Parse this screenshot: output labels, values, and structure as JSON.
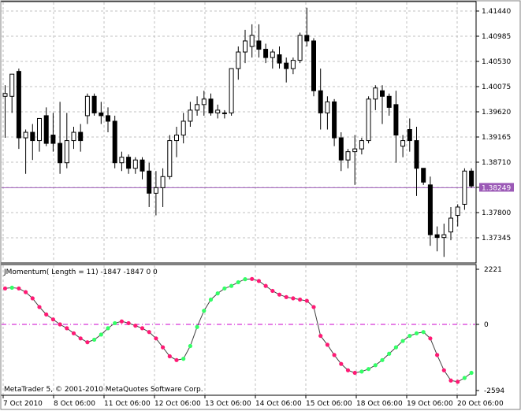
{
  "chart_data": [
    {
      "type": "candlestick",
      "instrument_timeframe": "",
      "price_axis_labels": [
        "1.41440",
        "1.40985",
        "1.40530",
        "1.40075",
        "1.39620",
        "1.39165",
        "1.38710",
        "1.38255",
        "1.37800",
        "1.37345"
      ],
      "current_price_label": "1.38249",
      "current_price": 1.38249,
      "ylim": [
        1.3695,
        1.4175
      ],
      "grid": true,
      "bullish_color": "#ffffff",
      "bearish_color": "#000000",
      "price_line_color": "#9b59b6",
      "candles": [
        {
          "o": 1.399,
          "h": 1.401,
          "l": 1.3915,
          "c": 1.3995
        },
        {
          "o": 1.399,
          "h": 1.402,
          "l": 1.396,
          "c": 1.403
        },
        {
          "o": 1.4035,
          "h": 1.404,
          "l": 1.3895,
          "c": 1.3915
        },
        {
          "o": 1.3915,
          "h": 1.393,
          "l": 1.385,
          "c": 1.3925
        },
        {
          "o": 1.3925,
          "h": 1.394,
          "l": 1.3875,
          "c": 1.391
        },
        {
          "o": 1.391,
          "h": 1.395,
          "l": 1.389,
          "c": 1.395
        },
        {
          "o": 1.3955,
          "h": 1.397,
          "l": 1.39,
          "c": 1.3905
        },
        {
          "o": 1.392,
          "h": 1.396,
          "l": 1.389,
          "c": 1.3905
        },
        {
          "o": 1.3905,
          "h": 1.398,
          "l": 1.385,
          "c": 1.387
        },
        {
          "o": 1.387,
          "h": 1.396,
          "l": 1.386,
          "c": 1.391
        },
        {
          "o": 1.391,
          "h": 1.3935,
          "l": 1.3895,
          "c": 1.3925
        },
        {
          "o": 1.3925,
          "h": 1.394,
          "l": 1.389,
          "c": 1.391
        },
        {
          "o": 1.3955,
          "h": 1.3995,
          "l": 1.394,
          "c": 1.399
        },
        {
          "o": 1.399,
          "h": 1.3995,
          "l": 1.3955,
          "c": 1.396
        },
        {
          "o": 1.396,
          "h": 1.398,
          "l": 1.394,
          "c": 1.3955
        },
        {
          "o": 1.3955,
          "h": 1.397,
          "l": 1.3925,
          "c": 1.3945
        },
        {
          "o": 1.3945,
          "h": 1.3955,
          "l": 1.386,
          "c": 1.387
        },
        {
          "o": 1.387,
          "h": 1.389,
          "l": 1.3855,
          "c": 1.388
        },
        {
          "o": 1.388,
          "h": 1.3885,
          "l": 1.385,
          "c": 1.386
        },
        {
          "o": 1.386,
          "h": 1.388,
          "l": 1.385,
          "c": 1.3875
        },
        {
          "o": 1.3875,
          "h": 1.388,
          "l": 1.384,
          "c": 1.3855
        },
        {
          "o": 1.3855,
          "h": 1.387,
          "l": 1.379,
          "c": 1.3815
        },
        {
          "o": 1.3815,
          "h": 1.3855,
          "l": 1.3775,
          "c": 1.3825
        },
        {
          "o": 1.3825,
          "h": 1.386,
          "l": 1.379,
          "c": 1.3845
        },
        {
          "o": 1.3845,
          "h": 1.392,
          "l": 1.384,
          "c": 1.391
        },
        {
          "o": 1.391,
          "h": 1.3935,
          "l": 1.388,
          "c": 1.392
        },
        {
          "o": 1.392,
          "h": 1.396,
          "l": 1.3905,
          "c": 1.3945
        },
        {
          "o": 1.3945,
          "h": 1.398,
          "l": 1.3935,
          "c": 1.3965
        },
        {
          "o": 1.3965,
          "h": 1.399,
          "l": 1.3955,
          "c": 1.3975
        },
        {
          "o": 1.3975,
          "h": 1.4,
          "l": 1.3955,
          "c": 1.3985
        },
        {
          "o": 1.3985,
          "h": 1.3995,
          "l": 1.3955,
          "c": 1.396
        },
        {
          "o": 1.396,
          "h": 1.3975,
          "l": 1.395,
          "c": 1.3965
        },
        {
          "o": 1.396,
          "h": 1.3965,
          "l": 1.395,
          "c": 1.396
        },
        {
          "o": 1.396,
          "h": 1.4015,
          "l": 1.3955,
          "c": 1.404
        },
        {
          "o": 1.404,
          "h": 1.408,
          "l": 1.402,
          "c": 1.407
        },
        {
          "o": 1.407,
          "h": 1.411,
          "l": 1.405,
          "c": 1.409
        },
        {
          "o": 1.408,
          "h": 1.412,
          "l": 1.406,
          "c": 1.41
        },
        {
          "o": 1.409,
          "h": 1.412,
          "l": 1.406,
          "c": 1.4075
        },
        {
          "o": 1.4075,
          "h": 1.4085,
          "l": 1.405,
          "c": 1.406
        },
        {
          "o": 1.406,
          "h": 1.4075,
          "l": 1.404,
          "c": 1.407
        },
        {
          "o": 1.4065,
          "h": 1.408,
          "l": 1.404,
          "c": 1.405
        },
        {
          "o": 1.405,
          "h": 1.406,
          "l": 1.4015,
          "c": 1.404
        },
        {
          "o": 1.404,
          "h": 1.406,
          "l": 1.403,
          "c": 1.4055
        },
        {
          "o": 1.4055,
          "h": 1.4105,
          "l": 1.405,
          "c": 1.41
        },
        {
          "o": 1.41,
          "h": 1.415,
          "l": 1.408,
          "c": 1.409
        },
        {
          "o": 1.409,
          "h": 1.4095,
          "l": 1.399,
          "c": 1.4
        },
        {
          "o": 1.4,
          "h": 1.404,
          "l": 1.393,
          "c": 1.396
        },
        {
          "o": 1.396,
          "h": 1.399,
          "l": 1.393,
          "c": 1.398
        },
        {
          "o": 1.398,
          "h": 1.3985,
          "l": 1.39,
          "c": 1.3915
        },
        {
          "o": 1.3915,
          "h": 1.3925,
          "l": 1.3855,
          "c": 1.3875
        },
        {
          "o": 1.3875,
          "h": 1.3895,
          "l": 1.386,
          "c": 1.389
        },
        {
          "o": 1.389,
          "h": 1.392,
          "l": 1.383,
          "c": 1.3895
        },
        {
          "o": 1.3895,
          "h": 1.3915,
          "l": 1.3885,
          "c": 1.391
        },
        {
          "o": 1.391,
          "h": 1.399,
          "l": 1.3905,
          "c": 1.3985
        },
        {
          "o": 1.3985,
          "h": 1.401,
          "l": 1.3965,
          "c": 1.4005
        },
        {
          "o": 1.4,
          "h": 1.401,
          "l": 1.394,
          "c": 1.399
        },
        {
          "o": 1.399,
          "h": 1.3995,
          "l": 1.3955,
          "c": 1.397
        },
        {
          "o": 1.3975,
          "h": 1.4,
          "l": 1.387,
          "c": 1.392
        },
        {
          "o": 1.39,
          "h": 1.392,
          "l": 1.388,
          "c": 1.391
        },
        {
          "o": 1.393,
          "h": 1.395,
          "l": 1.389,
          "c": 1.391
        },
        {
          "o": 1.391,
          "h": 1.3935,
          "l": 1.381,
          "c": 1.386
        },
        {
          "o": 1.386,
          "h": 1.386,
          "l": 1.383,
          "c": 1.3835
        },
        {
          "o": 1.383,
          "h": 1.3845,
          "l": 1.372,
          "c": 1.374
        },
        {
          "o": 1.374,
          "h": 1.3755,
          "l": 1.371,
          "c": 1.3735
        },
        {
          "o": 1.3735,
          "h": 1.376,
          "l": 1.37,
          "c": 1.374
        },
        {
          "o": 1.3745,
          "h": 1.379,
          "l": 1.373,
          "c": 1.377
        },
        {
          "o": 1.3775,
          "h": 1.3795,
          "l": 1.3755,
          "c": 1.379
        },
        {
          "o": 1.3795,
          "h": 1.386,
          "l": 1.3785,
          "c": 1.3855
        },
        {
          "o": 1.3855,
          "h": 1.386,
          "l": 1.3825,
          "c": 1.3828
        }
      ]
    },
    {
      "type": "line",
      "title": "JMomentum( Length = 11) -1847 -1847 0 0",
      "axis_labels": [
        "2221",
        "0",
        "-2594"
      ],
      "ylim": [
        -2594,
        2221
      ],
      "zero_line_color": "#cc00cc",
      "up_color": "#33ff66",
      "down_color": "#ff1a75",
      "values": [
        1450,
        1480,
        1450,
        1300,
        1050,
        700,
        400,
        200,
        0,
        -150,
        -350,
        -550,
        -700,
        -600,
        -400,
        -150,
        50,
        120,
        50,
        -50,
        -150,
        -300,
        -550,
        -900,
        -1250,
        -1400,
        -1350,
        -850,
        -100,
        550,
        1000,
        1250,
        1450,
        1550,
        1700,
        1820,
        1830,
        1750,
        1550,
        1350,
        1200,
        1100,
        1050,
        1000,
        950,
        700,
        -450,
        -800,
        -1200,
        -1550,
        -1800,
        -1900,
        -1850,
        -1750,
        -1600,
        -1400,
        -1150,
        -900,
        -650,
        -450,
        -350,
        -300,
        -550,
        -1200,
        -1800,
        -2200,
        -2250,
        -2100,
        -1900
      ],
      "colors": [
        "d",
        "u",
        "d",
        "d",
        "d",
        "d",
        "d",
        "d",
        "d",
        "d",
        "d",
        "d",
        "d",
        "u",
        "u",
        "u",
        "u",
        "d",
        "d",
        "d",
        "d",
        "d",
        "d",
        "d",
        "d",
        "d",
        "u",
        "u",
        "u",
        "u",
        "u",
        "u",
        "u",
        "u",
        "u",
        "u",
        "d",
        "d",
        "d",
        "d",
        "d",
        "d",
        "d",
        "d",
        "d",
        "d",
        "d",
        "d",
        "d",
        "d",
        "d",
        "d",
        "u",
        "u",
        "u",
        "u",
        "u",
        "u",
        "u",
        "u",
        "u",
        "u",
        "d",
        "d",
        "d",
        "d",
        "d",
        "u",
        "u"
      ]
    }
  ],
  "time_axis_labels": [
    "7 Oct 2010",
    "8 Oct 06:00",
    "11 Oct 06:00",
    "12 Oct 06:00",
    "13 Oct 06:00",
    "14 Oct 06:00",
    "15 Oct 06:00",
    "18 Oct 06:00",
    "19 Oct 06:00",
    "20 Oct 06:00"
  ],
  "copyright": "MetaTrader 5, © 2001-2010 MetaQuotes Software Corp."
}
